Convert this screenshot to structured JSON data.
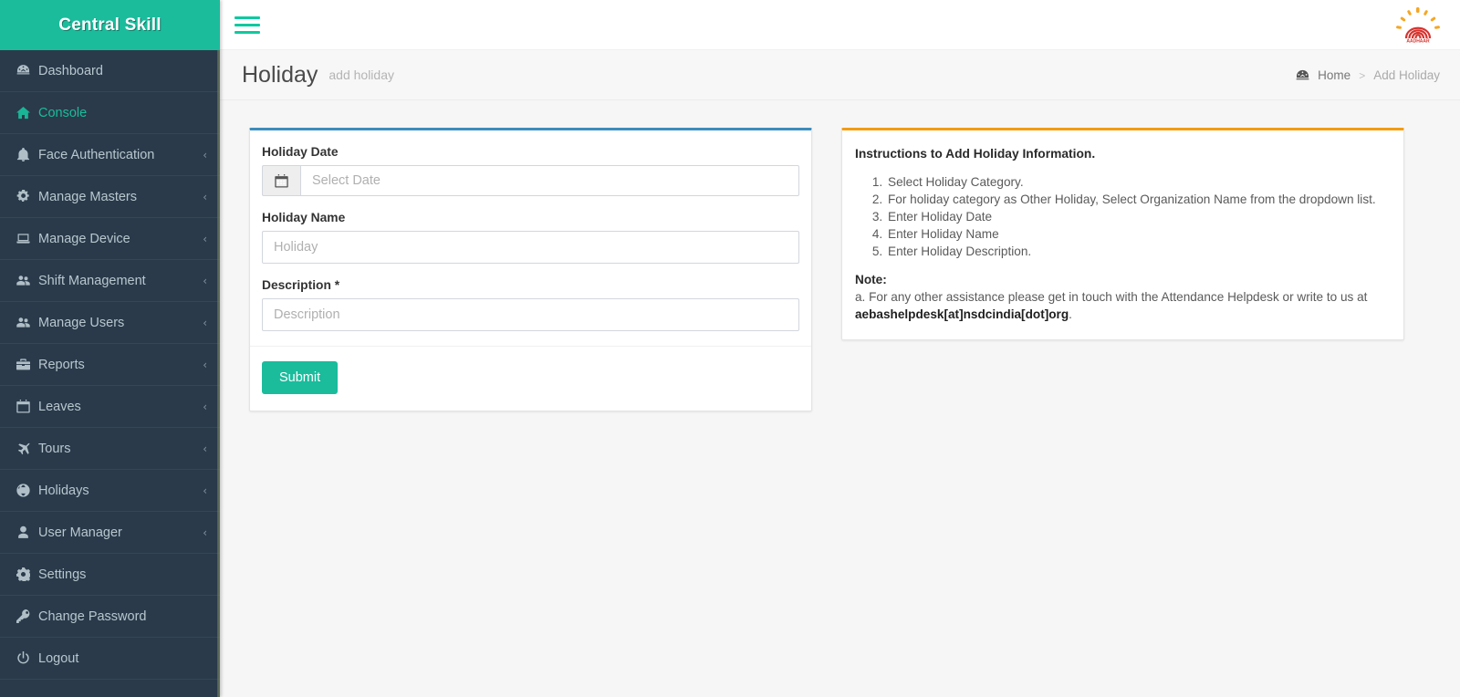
{
  "sidebar": {
    "brand": "Central Skill",
    "items": [
      {
        "label": "Dashboard",
        "icon": "dashboard-icon",
        "chevron": "",
        "active": false
      },
      {
        "label": "Console",
        "icon": "home-icon",
        "chevron": "",
        "active": true
      },
      {
        "label": "Face Authentication",
        "icon": "bell-icon",
        "chevron": "‹",
        "active": false
      },
      {
        "label": "Manage Masters",
        "icon": "gears-icon",
        "chevron": "‹",
        "active": false
      },
      {
        "label": "Manage Device",
        "icon": "laptop-icon",
        "chevron": "‹",
        "active": false
      },
      {
        "label": "Shift Management",
        "icon": "users-icon",
        "chevron": "‹",
        "active": false
      },
      {
        "label": "Manage Users",
        "icon": "users-icon",
        "chevron": "‹",
        "active": false
      },
      {
        "label": "Reports",
        "icon": "briefcase-icon",
        "chevron": "‹",
        "active": false
      },
      {
        "label": "Leaves",
        "icon": "calendar-icon",
        "chevron": "‹",
        "active": false
      },
      {
        "label": "Tours",
        "icon": "plane-icon",
        "chevron": "‹",
        "active": false
      },
      {
        "label": "Holidays",
        "icon": "globe-icon",
        "chevron": "‹",
        "active": false
      },
      {
        "label": "User Manager",
        "icon": "user-icon",
        "chevron": "‹",
        "active": false
      },
      {
        "label": "Settings",
        "icon": "gear-icon",
        "chevron": "",
        "active": false
      },
      {
        "label": "Change Password",
        "icon": "key-icon",
        "chevron": "",
        "active": false
      },
      {
        "label": "Logout",
        "icon": "power-icon",
        "chevron": "",
        "active": false
      }
    ]
  },
  "topbar": {
    "menu_toggle": "hamburger-icon",
    "logo_alt": "AADHAAR",
    "logo_text": "AADHAAR"
  },
  "pagehead": {
    "title": "Holiday",
    "subtitle": "add holiday",
    "breadcrumb": {
      "home": "Home",
      "separator": ">",
      "current": "Add Holiday"
    }
  },
  "form": {
    "fields": [
      {
        "label": "Holiday Date",
        "required": "",
        "placeholder": "Select Date",
        "value": "",
        "addon_icon": "calendar-icon"
      },
      {
        "label": "Holiday Name",
        "required": "",
        "placeholder": "Holiday",
        "value": ""
      },
      {
        "label": "Description",
        "required": "*",
        "placeholder": "Description",
        "value": ""
      }
    ],
    "submit_label": "Submit"
  },
  "instructions": {
    "title": "Instructions to Add Holiday Information.",
    "steps": [
      "Select Holiday Category.",
      "For holiday category as Other Holiday, Select Organization Name from the dropdown list.",
      "Enter Holiday Date",
      "Enter Holiday Name",
      "Enter Holiday Description."
    ],
    "note_title": "Note:",
    "note_prefix": "a. For any other assistance please get in touch with the Attendance Helpdesk or write to us at ",
    "note_email": "aebashelpdesk[at]nsdcindia[dot]org",
    "note_suffix": "."
  },
  "colors": {
    "brand_teal": "#1abc9c",
    "sidebar_dark": "#2a3a4a",
    "form_accent": "#3c8dbc",
    "info_accent": "#f39c12",
    "aadhaar_red": "#d7332e",
    "aadhaar_orange": "#f5a623"
  }
}
